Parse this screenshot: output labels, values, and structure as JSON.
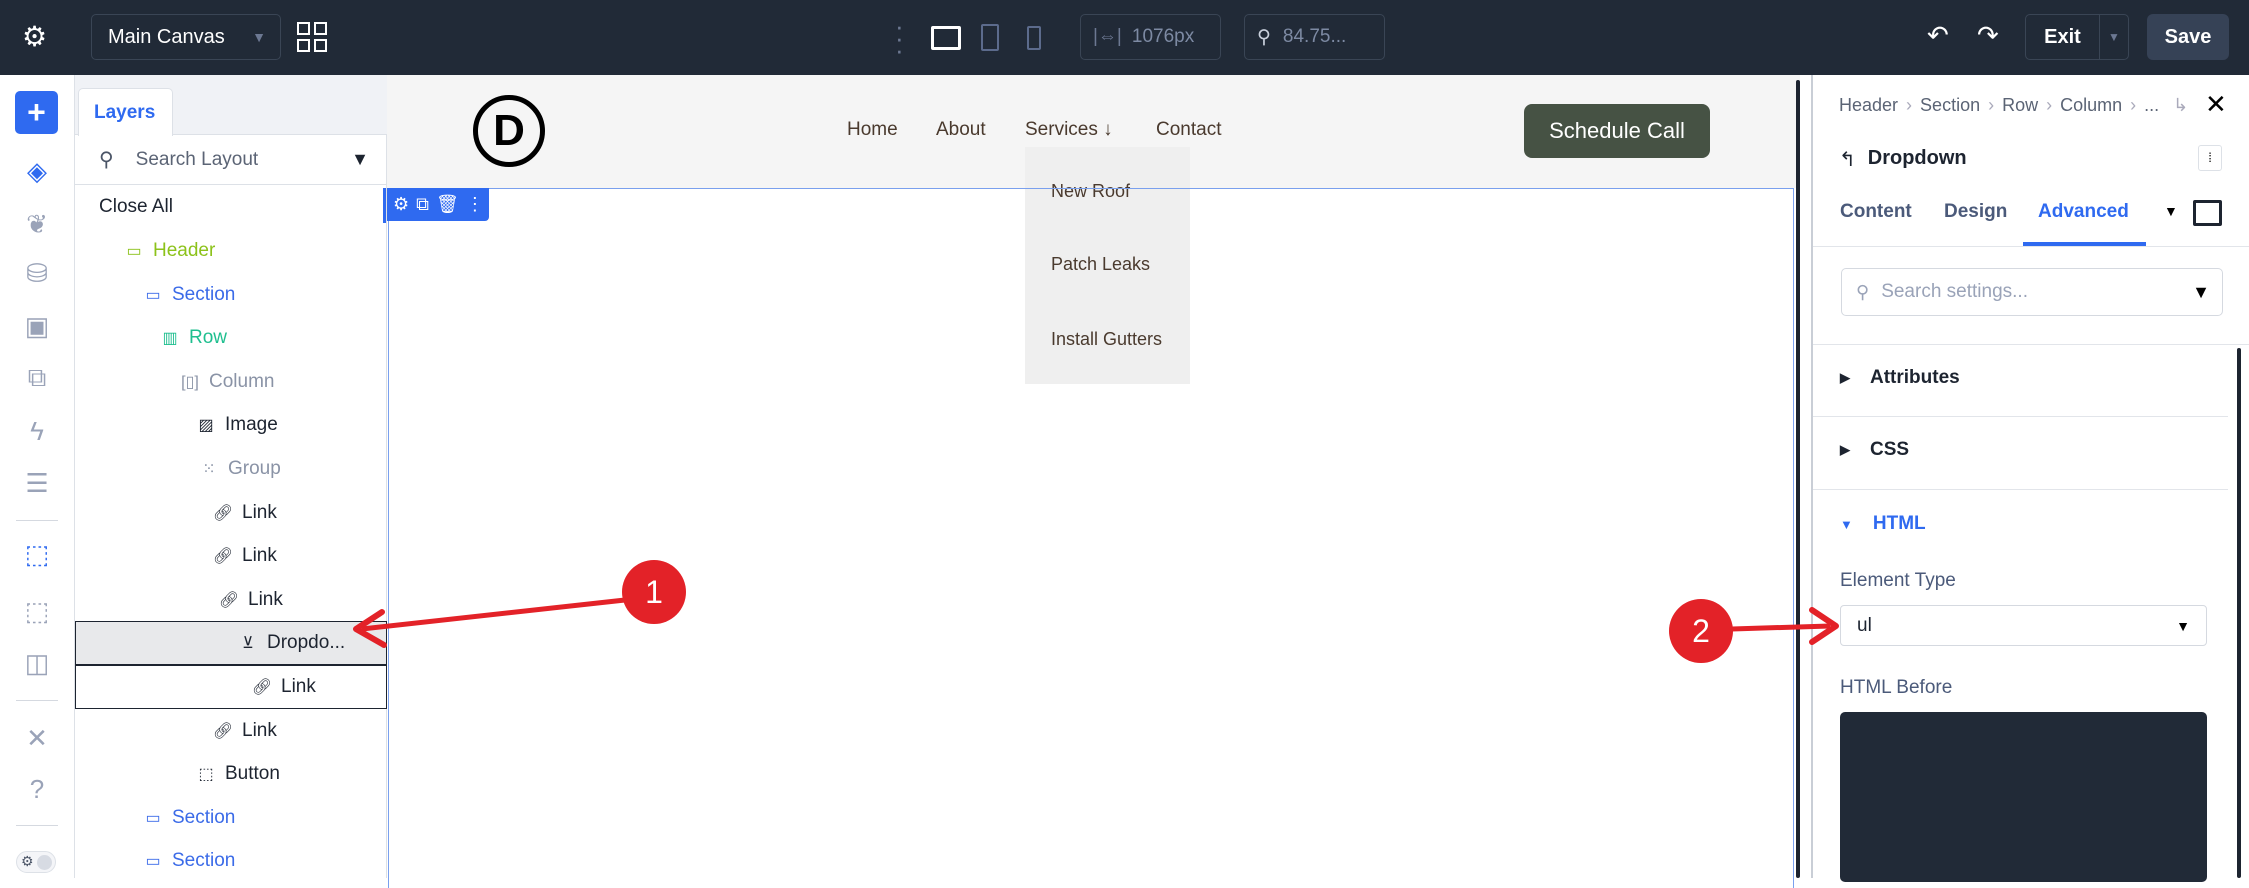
{
  "topbar": {
    "canvas_select": "Main Canvas",
    "width_value": "1076px",
    "zoom_value": "84.75...",
    "exit_label": "Exit",
    "save_label": "Save"
  },
  "layers": {
    "tab": "Layers",
    "search_placeholder": "Search Layout",
    "close_all": "Close All",
    "items": [
      {
        "label": "Header",
        "icon": "header-icon",
        "color": "#8cc21a"
      },
      {
        "label": "Section",
        "icon": "section-icon",
        "color": "#3b6be8"
      },
      {
        "label": "Row",
        "icon": "row-icon",
        "color": "#1fbf8f"
      },
      {
        "label": "Column",
        "icon": "column-icon",
        "color": "#8a93a6"
      },
      {
        "label": "Image",
        "icon": "image-icon",
        "color": "#1d2430"
      },
      {
        "label": "Group",
        "icon": "group-icon",
        "color": "#8a93a6"
      },
      {
        "label": "Link",
        "icon": "link-icon",
        "color": "#1d2430"
      },
      {
        "label": "Link",
        "icon": "link-icon",
        "color": "#1d2430"
      },
      {
        "label": "Link",
        "icon": "link-icon",
        "color": "#1d2430"
      },
      {
        "label": "Dropdo...",
        "icon": "dropdown-icon",
        "color": "#1d2430"
      },
      {
        "label": "Link",
        "icon": "link-icon",
        "color": "#1d2430"
      },
      {
        "label": "Link",
        "icon": "link-icon",
        "color": "#1d2430"
      },
      {
        "label": "Button",
        "icon": "button-icon",
        "color": "#1d2430"
      },
      {
        "label": "Section",
        "icon": "section-icon",
        "color": "#3b6be8"
      },
      {
        "label": "Section",
        "icon": "section-icon",
        "color": "#3b6be8"
      }
    ]
  },
  "site": {
    "logo_letter": "D",
    "nav": [
      "Home",
      "About",
      "Services ↓",
      "Contact"
    ],
    "dropdown": [
      "New Roof",
      "Patch Leaks",
      "Install Gutters"
    ],
    "cta": "Schedule Call"
  },
  "panel": {
    "breadcrumb": [
      "Header",
      "Section",
      "Row",
      "Column",
      "..."
    ],
    "title": "Dropdown",
    "tabs": [
      "Content",
      "Design",
      "Advanced"
    ],
    "active_tab": "Advanced",
    "search_placeholder": "Search settings...",
    "sections": [
      "Attributes",
      "CSS",
      "HTML"
    ],
    "element_type_label": "Element Type",
    "element_type_value": "ul",
    "html_before_label": "HTML Before"
  },
  "annotations": [
    "1",
    "2"
  ],
  "colors": {
    "accent": "#2f6af0",
    "topbar": "#212a37",
    "cta": "#465244",
    "annotation": "#e32228"
  }
}
